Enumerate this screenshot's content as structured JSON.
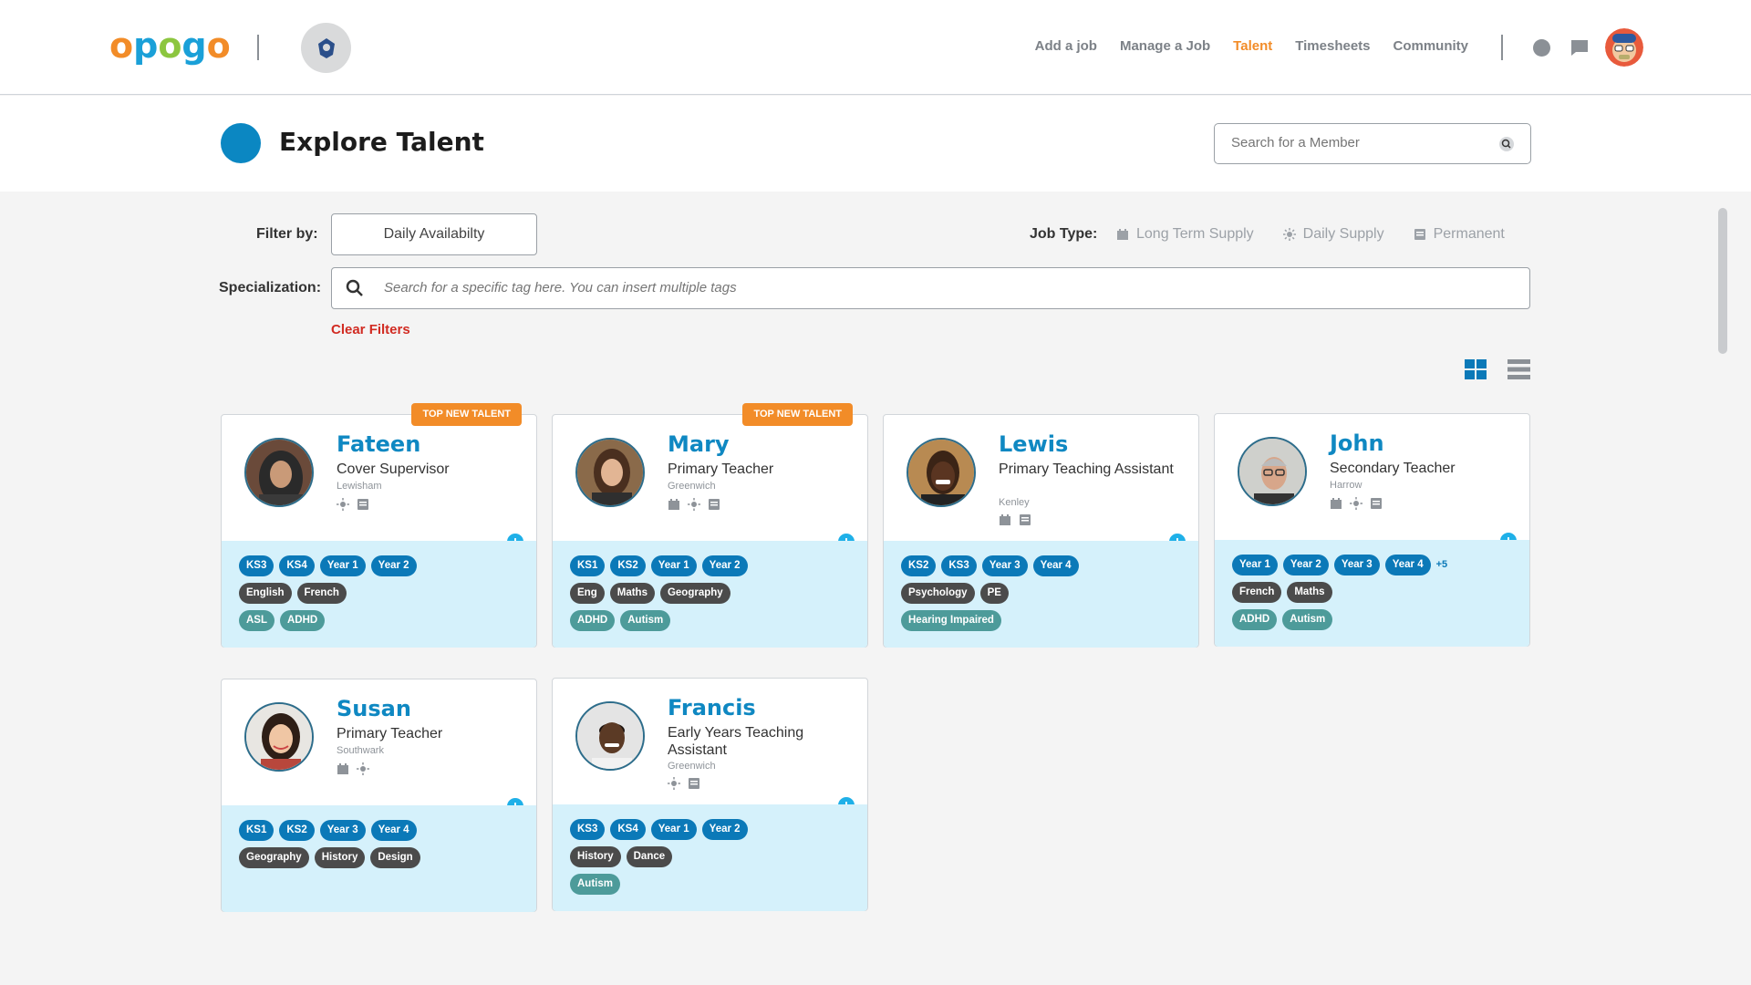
{
  "brand": {
    "logo_letters": [
      "o",
      "p",
      "o",
      "g",
      "o"
    ]
  },
  "nav": {
    "items": [
      {
        "label": "Add a job"
      },
      {
        "label": "Manage a Job"
      },
      {
        "label": "Talent",
        "active": true
      },
      {
        "label": "Timesheets"
      },
      {
        "label": "Community"
      }
    ]
  },
  "page": {
    "title": "Explore Talent"
  },
  "member_search": {
    "placeholder": "Search for a Member"
  },
  "filters": {
    "filter_by_label": "Filter by:",
    "filter_button": "Daily Availabilty",
    "job_type_label": "Job Type:",
    "job_types": [
      "Long Term Supply",
      "Daily Supply",
      "Permanent"
    ],
    "specialization_label": "Specialization:",
    "specialization_placeholder": "Search for a specific tag here. You can insert multiple tags",
    "clear_filters": "Clear Filters"
  },
  "colors": {
    "accent_orange": "#f28c28",
    "primary_blue": "#0f88c2",
    "tag_blue": "#0b79b8",
    "tag_dark": "#4b4b4b",
    "tag_teal": "#4d9b9a",
    "card_lower_bg": "#d5f1fb"
  },
  "talent": [
    {
      "name": "Fateen",
      "role": "Cover Supervisor",
      "location": "Lewisham",
      "badge": "TOP NEW TALENT",
      "icons": [
        "daily-supply-icon",
        "permanent-icon"
      ],
      "tags": [
        [
          "KS3",
          "KS4",
          "Year 1",
          "Year 2"
        ],
        [
          "English",
          "French"
        ],
        [
          "ASL",
          "ADHD"
        ]
      ]
    },
    {
      "name": "Mary",
      "role": "Primary Teacher",
      "location": "Greenwich",
      "badge": "TOP NEW TALENT",
      "icons": [
        "long-term-icon",
        "daily-supply-icon",
        "permanent-icon"
      ],
      "tags": [
        [
          "KS1",
          "KS2",
          "Year 1",
          "Year 2"
        ],
        [
          "Eng",
          "Maths",
          "Geography"
        ],
        [
          "ADHD",
          "Autism"
        ]
      ]
    },
    {
      "name": "Lewis",
      "role": "Primary Teaching Assistant",
      "location": "Kenley",
      "badge": "",
      "icons": [
        "long-term-icon",
        "permanent-icon"
      ],
      "tags": [
        [
          "KS2",
          "KS3",
          "Year 3",
          "Year 4"
        ],
        [
          "Psychology",
          "PE"
        ],
        [
          "Hearing Impaired"
        ]
      ]
    },
    {
      "name": "John",
      "role": "Secondary Teacher",
      "location": "Harrow",
      "badge": "",
      "icons": [
        "long-term-icon",
        "daily-supply-icon",
        "permanent-icon"
      ],
      "tags": [
        [
          "Year 1",
          "Year 2",
          "Year 3",
          "Year 4"
        ],
        [
          "French",
          "Maths"
        ],
        [
          "ADHD",
          "Autism"
        ]
      ],
      "more": "+5"
    },
    {
      "name": "Susan",
      "role": "Primary Teacher",
      "location": "Southwark",
      "badge": "",
      "icons": [
        "long-term-icon",
        "daily-supply-icon"
      ],
      "tags": [
        [
          "KS1",
          "KS2",
          "Year 3",
          "Year 4"
        ],
        [
          "Geography",
          "History",
          "Design"
        ],
        []
      ]
    },
    {
      "name": "Francis",
      "role": "Early Years Teaching Assistant",
      "location": "Greenwich",
      "badge": "",
      "icons": [
        "daily-supply-icon",
        "permanent-icon"
      ],
      "tags": [
        [
          "KS3",
          "KS4",
          "Year 1",
          "Year 2"
        ],
        [
          "History",
          "Dance"
        ],
        [
          "Autism"
        ]
      ]
    }
  ]
}
